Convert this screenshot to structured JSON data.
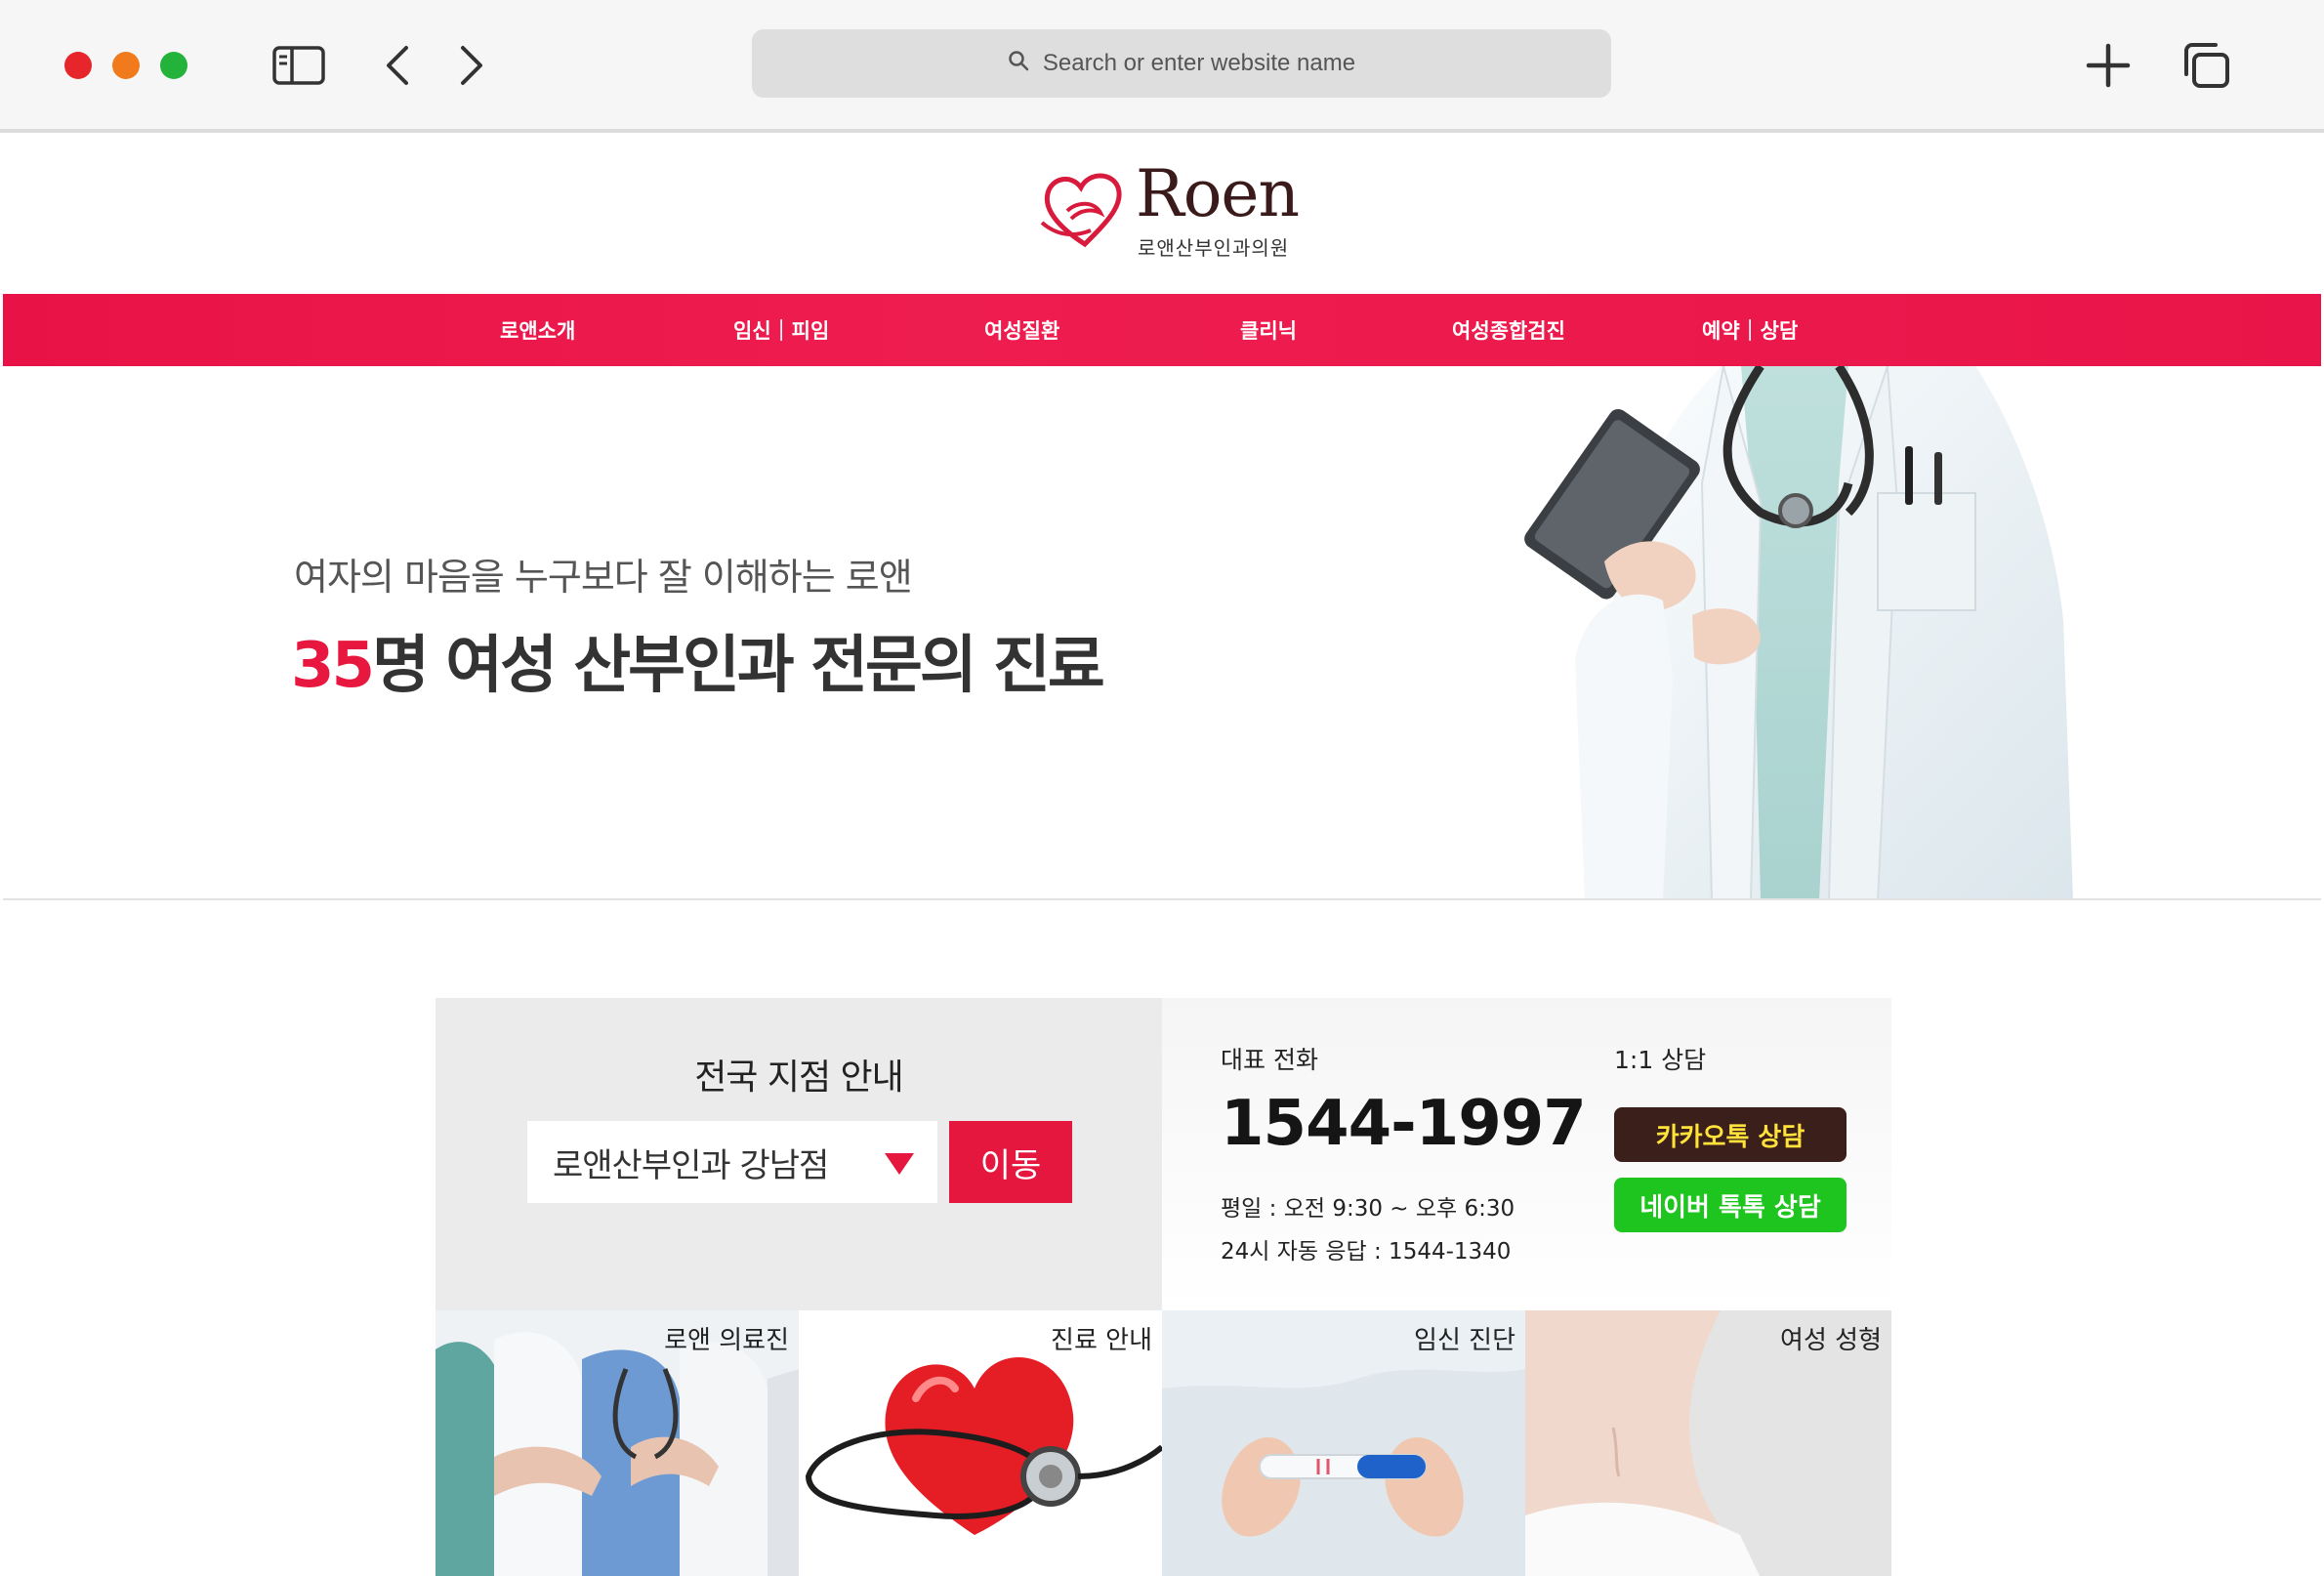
{
  "browser": {
    "url_placeholder": "Search or enter website name",
    "icons": [
      "sidebar-icon",
      "chevron-left-icon",
      "chevron-right-icon",
      "search-icon",
      "plus-icon",
      "tabs-icon"
    ]
  },
  "site": {
    "logo_name": "Roen",
    "logo_sub": "로앤산부인과의원",
    "nav": [
      "로앤소개",
      "임신｜피임",
      "여성질환",
      "클리닉",
      "여성종합검진",
      "예약｜상담"
    ],
    "colors": {
      "brand_red": "#e8173f",
      "kakao_bg": "#3b1f1a",
      "kakao_text": "#ffe23a",
      "naver_green": "#1ec51e"
    }
  },
  "hero": {
    "subtitle": "여자의 마음을 누구보다 잘 이해하는 로앤",
    "title_number": "35",
    "title_rest": "명 여성 산부인과 전문의 진료"
  },
  "branch": {
    "title": "전국 지점 안내",
    "selected": "로앤산부인과 강남점",
    "go_label": "이동"
  },
  "contact": {
    "phone_label": "대표 전화",
    "phone": "1544-1997",
    "hours": "평일 : 오전 9:30 ~ 오후 6:30",
    "auto": "24시 자동 응답 : 1544-1340",
    "consult_label": "1:1 상담",
    "kakao": "카카오톡 상담",
    "naver": "네이버 톡톡 상담"
  },
  "tiles": [
    "로앤 의료진",
    "진료 안내",
    "임신 진단",
    "여성 성형"
  ]
}
